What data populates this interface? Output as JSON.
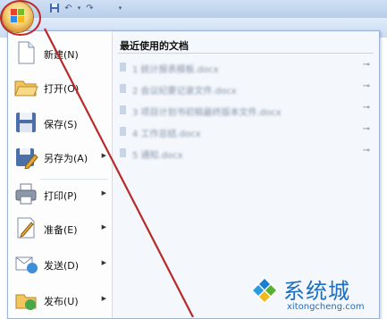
{
  "quick_access": {
    "icons": [
      "save-icon",
      "undo-icon",
      "redo-icon",
      "customize-dropdown-icon"
    ]
  },
  "menu": {
    "commands": [
      {
        "label": "新建(N)",
        "icon": "new-document-icon",
        "has_submenu": false
      },
      {
        "label": "打开(O)",
        "icon": "open-folder-icon",
        "has_submenu": false
      },
      {
        "label": "保存(S)",
        "icon": "save-disk-icon",
        "has_submenu": false
      },
      {
        "label": "另存为(A)",
        "icon": "save-as-icon",
        "has_submenu": true
      },
      {
        "label": "打印(P)",
        "icon": "printer-icon",
        "has_submenu": true
      },
      {
        "label": "准备(E)",
        "icon": "prepare-icon",
        "has_submenu": true
      },
      {
        "label": "发送(D)",
        "icon": "send-icon",
        "has_submenu": true
      },
      {
        "label": "发布(U)",
        "icon": "publish-icon",
        "has_submenu": true
      }
    ],
    "recent_title": "最近使用的文档",
    "recent_docs": [
      "1 统计报表模板.docx",
      "2 会议纪要记录文件.docx",
      "3 项目计划书初稿最终版本文件.docx",
      "4 工作总结.docx",
      "5 通知.docx"
    ]
  },
  "watermark": {
    "brand": "系统城",
    "url": "xitongcheng.com"
  },
  "colors": {
    "annotation_red": "#c2282a",
    "menu_border": "#9bb3d6",
    "watermark_blue": "#1a6fc2"
  }
}
